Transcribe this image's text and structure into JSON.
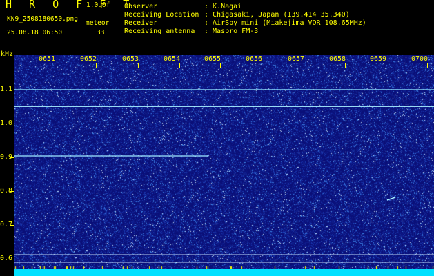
{
  "header": {
    "app_title": "H R O F F T",
    "version": "1.0.0f",
    "filename": "KN9_2508180650.png",
    "mode": "meteor",
    "datetime": "25.08.18 06:50",
    "count": "33"
  },
  "info": [
    {
      "label": "Observer",
      "value": ":  K.Nagai"
    },
    {
      "label": "Receiving Location",
      "value": ":  Chigasaki, Japan (139.414 35.340)"
    },
    {
      "label": "Receiver",
      "value": ":  AirSpy mini (Miakejima VOR 108.65MHz)"
    },
    {
      "label": "Receiving antenna",
      "value": ":  Maspro FM-3"
    }
  ],
  "axis": {
    "y_unit": "kHz",
    "y_ticks": [
      "1.1",
      "1.0",
      "0.9",
      "0.8",
      "0.7",
      "0.6"
    ],
    "time_ticks": [
      "0651",
      "0652",
      "0653",
      "0654",
      "0655",
      "0656",
      "0657",
      "0658",
      "0659",
      "0700"
    ]
  },
  "colors": {
    "background": "#000000",
    "text": "#ffff00",
    "waterfall_bg": "#0a0f78",
    "signal_line": "#7fe0ff",
    "floor": "#00e0ff"
  }
}
